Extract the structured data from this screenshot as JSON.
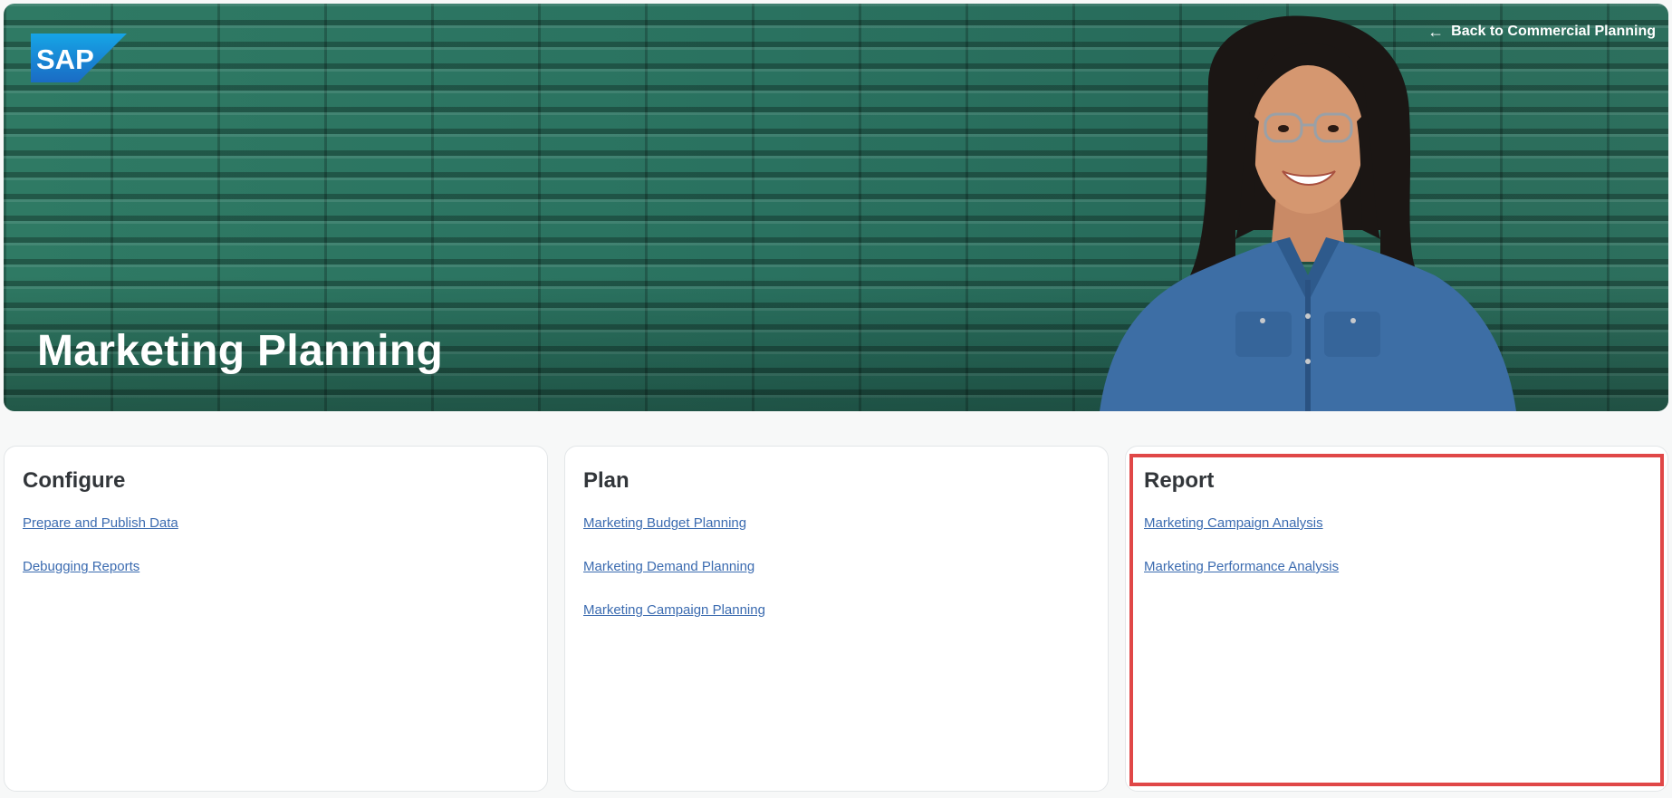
{
  "hero": {
    "title": "Marketing Planning",
    "back_link": "Back to Commercial Planning",
    "logo_text": "SAP",
    "logo_color": "#1b7cc9"
  },
  "cards": [
    {
      "title": "Configure",
      "links": [
        "Prepare and Publish Data",
        "Debugging Reports"
      ]
    },
    {
      "title": "Plan",
      "links": [
        "Marketing Budget Planning",
        "Marketing Demand Planning",
        "Marketing Campaign Planning"
      ]
    },
    {
      "title": "Report",
      "links": [
        "Marketing Campaign Analysis",
        "Marketing Performance Analysis"
      ]
    }
  ],
  "colors": {
    "link": "#3b6bb0",
    "heading": "#32363a",
    "highlight": "#e04747",
    "hero_green": "#2a7260"
  },
  "icons": {
    "back": "arrow-left-icon"
  }
}
